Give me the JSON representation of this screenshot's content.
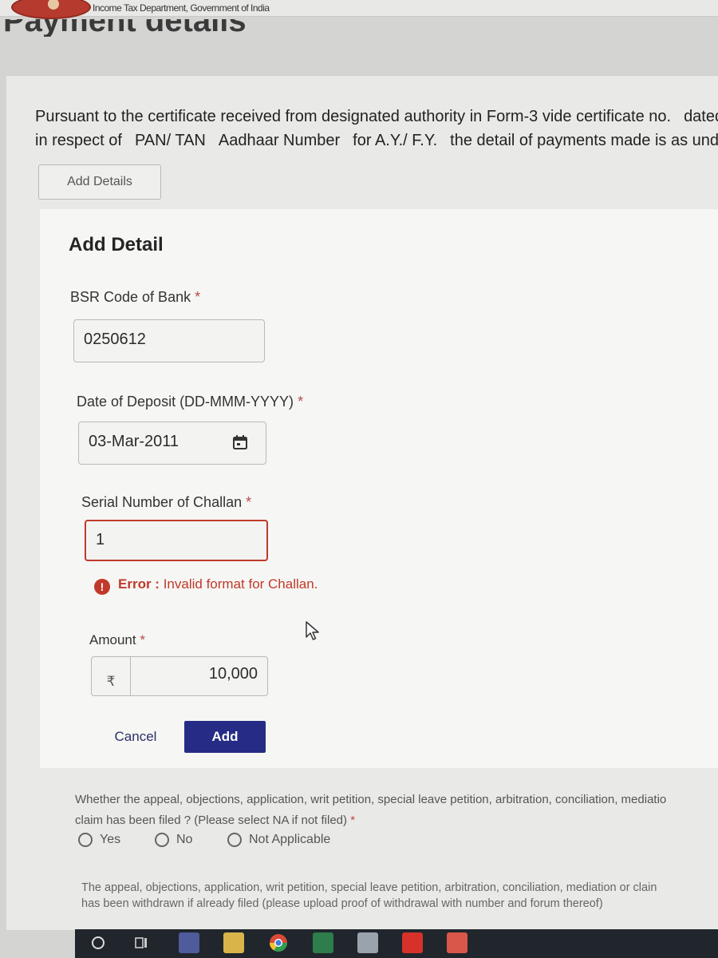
{
  "header": {
    "department": "Income Tax Department, Government of India",
    "page_title": "Payment details"
  },
  "intro": {
    "line1_parts": [
      "Pursuant to the certificate received from designated authority in Form-3 vide certificate no.",
      "dated"
    ],
    "line2_parts": [
      "in respect of",
      "PAN/ TAN",
      "Aadhaar Number",
      "for A.Y./ F.Y.",
      "the detail of payments made is as unde"
    ]
  },
  "add_details_button": "Add Details",
  "form": {
    "title": "Add Detail",
    "bsr": {
      "label": "BSR Code of Bank",
      "required": "*",
      "value": "0250612"
    },
    "date": {
      "label": "Date of Deposit (DD-MMM-YYYY)",
      "required": "*",
      "value": "03-Mar-2011"
    },
    "serial": {
      "label": "Serial Number of Challan",
      "required": "*",
      "value": "1"
    },
    "error": {
      "prefix": "Error :",
      "message": "Invalid format for Challan."
    },
    "amount": {
      "label": "Amount",
      "required": "*",
      "currency": "₹",
      "value": "10,000"
    },
    "cancel": "Cancel",
    "add": "Add"
  },
  "question": {
    "line1": "Whether the appeal, objections, application, writ petition, special leave petition, arbitration, conciliation, mediatio",
    "line2": "claim has been filed ? (Please select NA if not filed)",
    "required": "*",
    "options": [
      "Yes",
      "No",
      "Not Applicable"
    ]
  },
  "note": {
    "line1": "The appeal, objections, application, writ petition, special leave petition, arbitration, conciliation, mediation or clain",
    "line2": "has been withdrawn if already filed (please upload proof of withdrawal with number and forum thereof)"
  },
  "colors": {
    "primary_button": "#262c86",
    "error": "#c0392b"
  },
  "taskbar_icons": [
    "start-icon",
    "task-view-icon",
    "book-app-icon",
    "file-explorer-icon",
    "chrome-icon",
    "excel-icon",
    "files-icon",
    "acrobat-icon",
    "presentation-app-icon"
  ]
}
